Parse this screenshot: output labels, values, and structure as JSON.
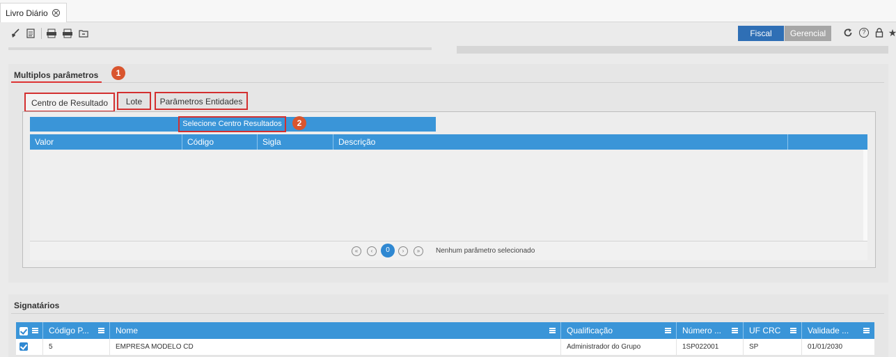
{
  "window_tab": {
    "title": "Livro Diário"
  },
  "mode_toggle": {
    "fiscal": "Fiscal",
    "gerencial": "Gerencial"
  },
  "toolbar_icons": [
    "broom-icon",
    "document-icon",
    "export-pdf-icon",
    "export-xls-icon",
    "folder-icon"
  ],
  "header_icons": [
    "refresh-icon",
    "help-icon",
    "lock-icon",
    "star-icon"
  ],
  "multiplos": {
    "title": "Multiplos parâmetros",
    "badge1": "1",
    "badge2": "2",
    "tabs": [
      {
        "label": "Centro de Resultado"
      },
      {
        "label": "Lote"
      },
      {
        "label": "Parâmetros Entidades"
      }
    ],
    "select_button": "Selecione Centro Resultados",
    "columns": [
      "Valor",
      "Código",
      "Sigla",
      "Descrição",
      ""
    ],
    "pager": {
      "current_page": "0",
      "status": "Nenhum parâmetro selecionado"
    }
  },
  "signatarios": {
    "title": "Signatários",
    "columns": [
      "",
      "Código P...",
      "Nome",
      "Qualificação",
      "Número ...",
      "UF CRC",
      "Validade ..."
    ],
    "rows": [
      {
        "checked": true,
        "codigo": "5",
        "nome": "EMPRESA MODELO CD",
        "qualificacao": "Administrador do Grupo",
        "numero": "1SP022001",
        "uf": "SP",
        "validade": "01/01/2030"
      }
    ]
  }
}
